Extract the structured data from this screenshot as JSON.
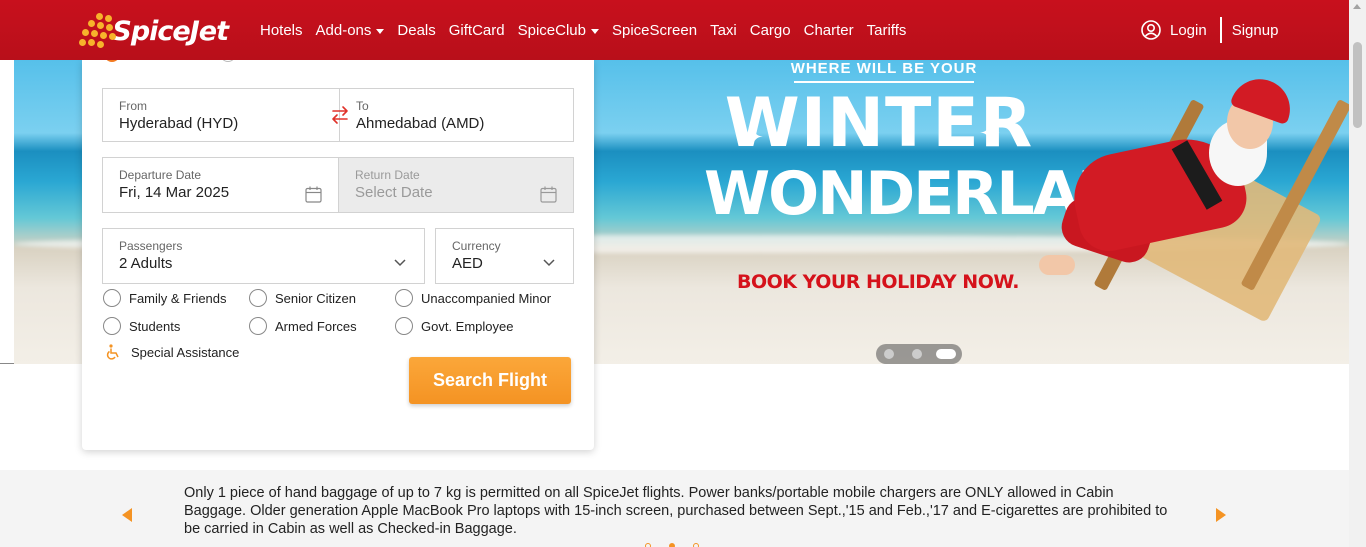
{
  "brand": {
    "name": "SpiceJet",
    "primary_color": "#c8101d",
    "accent_color": "#f49323"
  },
  "nav": {
    "items": [
      {
        "label": "Hotels",
        "dropdown": false
      },
      {
        "label": "Add-ons",
        "dropdown": true
      },
      {
        "label": "Deals",
        "dropdown": false
      },
      {
        "label": "GiftCard",
        "dropdown": false
      },
      {
        "label": "SpiceClub",
        "dropdown": true
      },
      {
        "label": "SpiceScreen",
        "dropdown": false
      },
      {
        "label": "Taxi",
        "dropdown": false
      },
      {
        "label": "Cargo",
        "dropdown": false
      },
      {
        "label": "Charter",
        "dropdown": false
      },
      {
        "label": "Tariffs",
        "dropdown": false
      }
    ],
    "login_label": "Login",
    "signup_label": "Signup"
  },
  "booking": {
    "from": {
      "label": "From",
      "value": "Hyderabad (HYD)"
    },
    "to": {
      "label": "To",
      "value": "Ahmedabad (AMD)"
    },
    "departure": {
      "label": "Departure Date",
      "value": "Fri, 14 Mar 2025"
    },
    "return": {
      "label": "Return Date",
      "placeholder": "Select Date",
      "disabled": true
    },
    "passengers": {
      "label": "Passengers",
      "value": "2 Adults"
    },
    "currency": {
      "label": "Currency",
      "value": "AED"
    },
    "fare_options": [
      "Family & Friends",
      "Senior Citizen",
      "Unaccompanied Minor",
      "Students",
      "Armed Forces",
      "Govt. Employee"
    ],
    "special_assistance_label": "Special Assistance",
    "search_button_label": "Search Flight"
  },
  "hero": {
    "headline": "WHERE WILL BE YOUR",
    "title_line1": "WINTER",
    "title_line2": "WONDERLAND",
    "cta": "BOOK YOUR HOLIDAY NOW.",
    "slides_total": 3,
    "active_slide": 3
  },
  "notice": {
    "text": "Only 1 piece of hand baggage of up to 7 kg is permitted on all SpiceJet flights. Power banks/portable mobile chargers are ONLY allowed in Cabin Baggage. Older generation Apple MacBook Pro laptops with 15-inch screen, purchased between Sept.,'15 and Feb.,'17 and E-cigarettes are prohibited to be carried in Cabin as well as Checked-in Baggage.",
    "pages_total": 3,
    "active_page": 2
  }
}
